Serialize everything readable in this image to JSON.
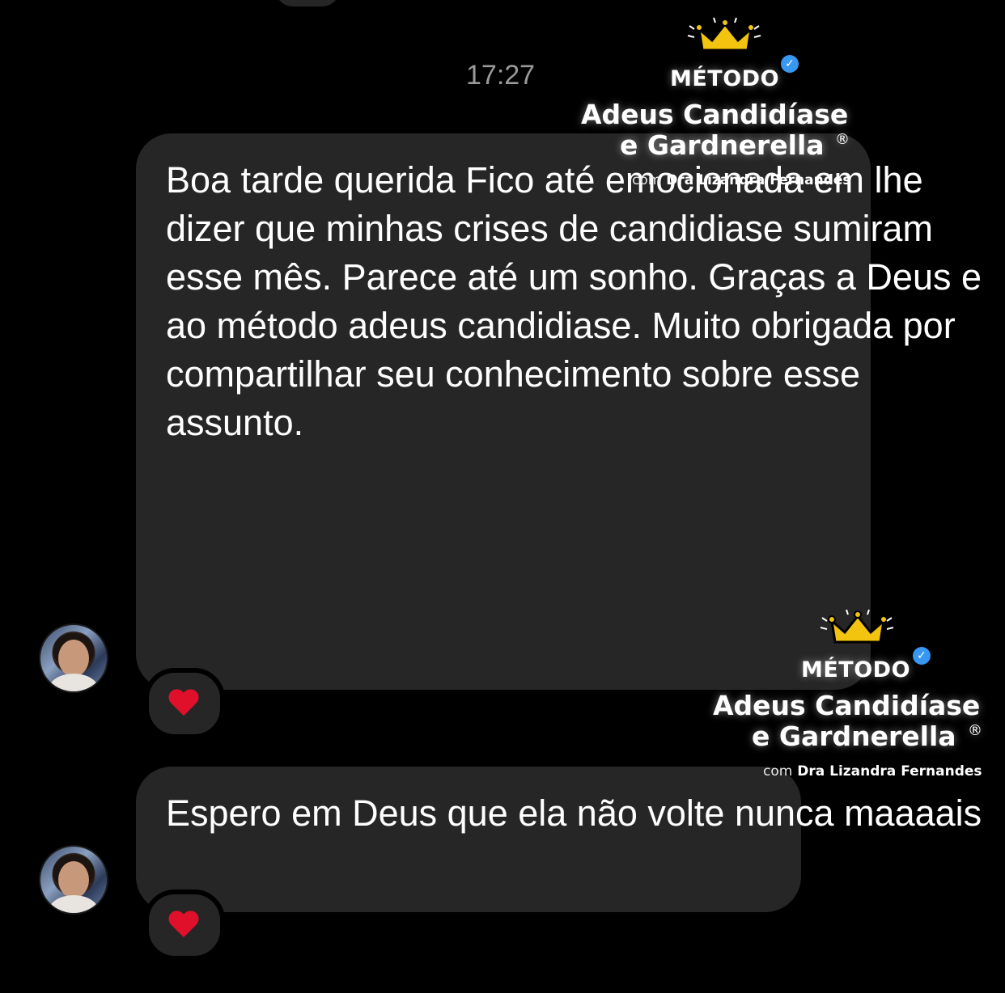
{
  "timestamp": "17:27",
  "messages": [
    {
      "lines_a": [
        "Boa tarde querida",
        "Fico até emocionada em lhe dizer que",
        "minhas crises de candidiase sumiram",
        "esse mês. Parece até um sonho."
      ],
      "lines_b": [
        "Graças a Deus e ao método adeus",
        "candidiase."
      ],
      "lines_c": [
        "Muito obrigada por compartilhar seu",
        "conhecimento sobre esse assunto."
      ],
      "reaction": "❤️"
    },
    {
      "lines": [
        "Espero em Deus que ela não volte",
        "nunca maaaais"
      ],
      "reaction": "❤️"
    }
  ],
  "watermark": {
    "metodo": "MÉTODO",
    "title_line1": "Adeus Candidíase",
    "title_line2": "e Gardnerella",
    "registered": "®",
    "sub_prefix": "com",
    "sub_name": "Dra Lizandra Fernandes",
    "verified_glyph": "✓"
  },
  "colors": {
    "background": "#000000",
    "bubble": "#262626",
    "timestamp": "#9a9a9a",
    "heart": "#e0102a",
    "crown": "#f2c40f",
    "verified": "#3897f0"
  }
}
